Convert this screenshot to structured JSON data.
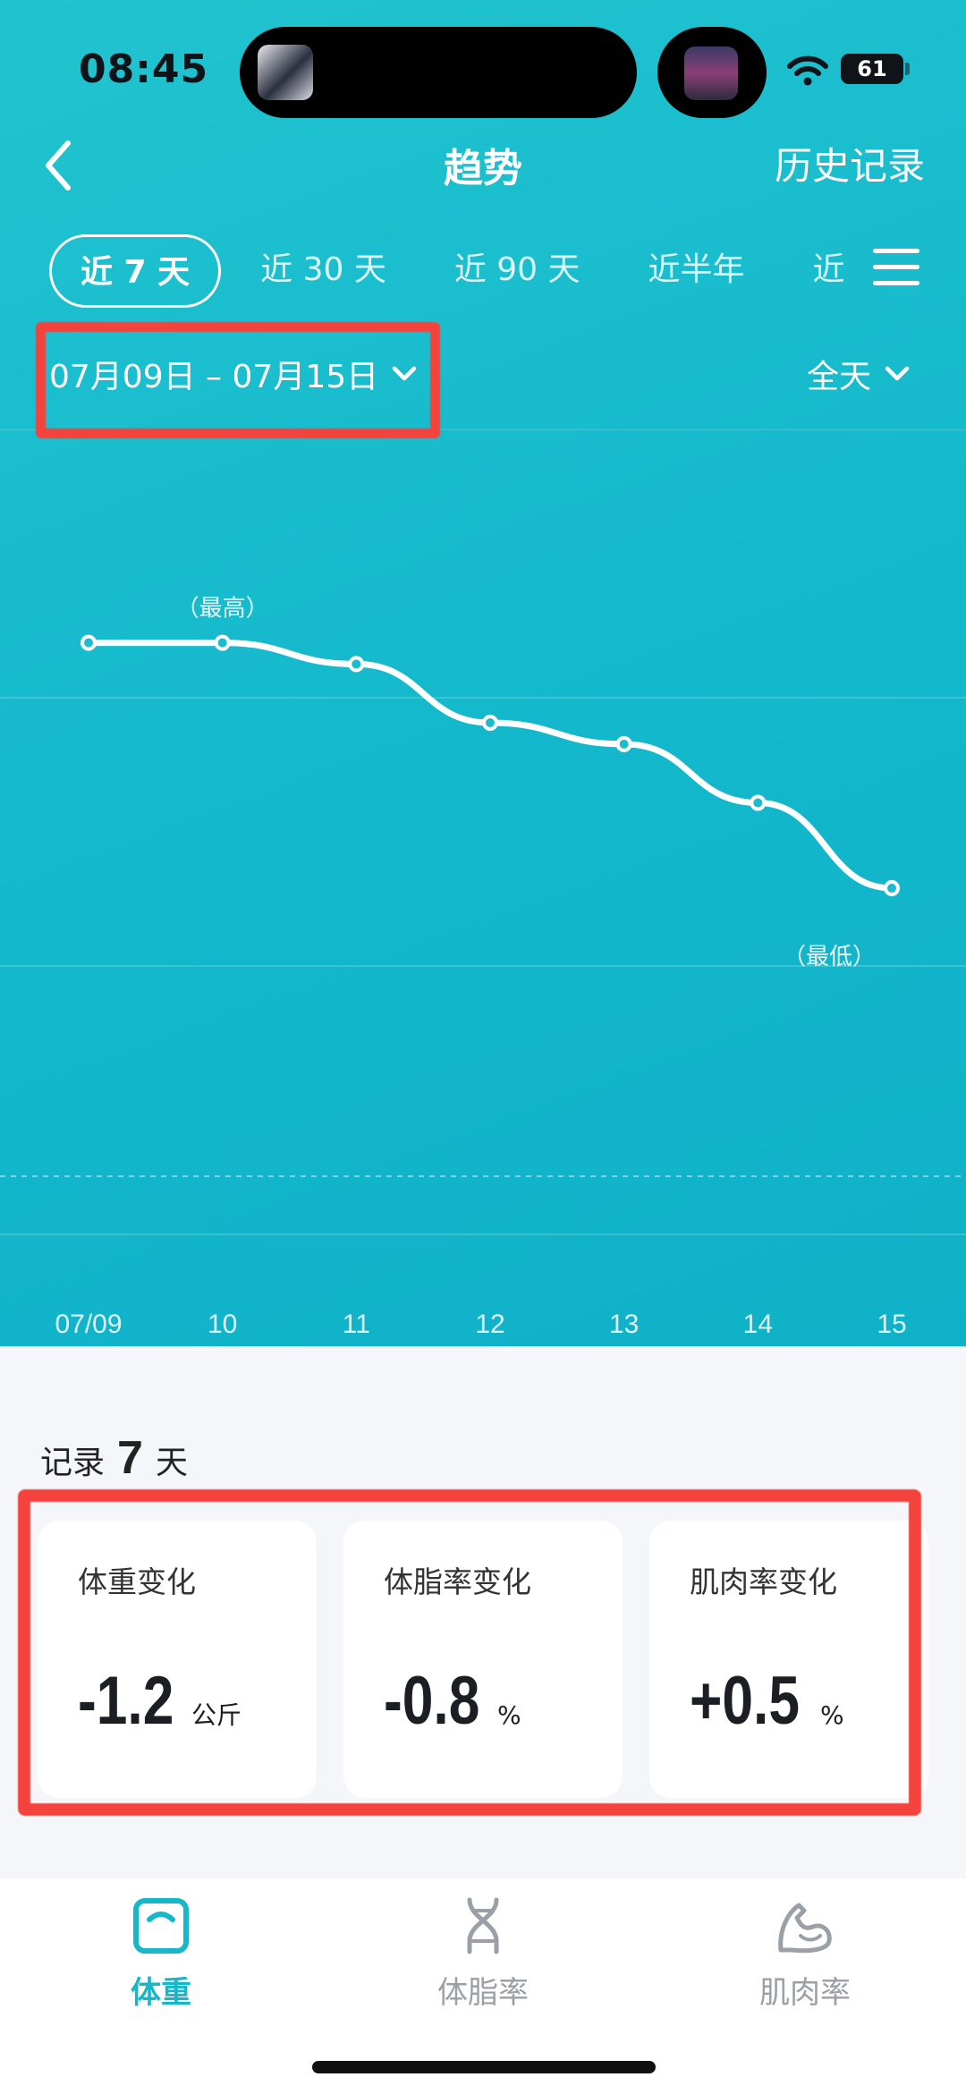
{
  "status_bar": {
    "time": "08:45",
    "battery": "61"
  },
  "header": {
    "title": "趋势",
    "right_action": "历史记录"
  },
  "tabs": [
    {
      "label": "近 7 天",
      "active": true
    },
    {
      "label": "近 30 天"
    },
    {
      "label": "近 90 天"
    },
    {
      "label": "近半年"
    },
    {
      "label": "近"
    }
  ],
  "date_range": "07月09日 – 07月15日",
  "period_select": "全天",
  "chart_data": {
    "type": "line",
    "x": [
      "07/09",
      "10",
      "11",
      "12",
      "13",
      "14",
      "15"
    ],
    "series": [
      {
        "values": [
          10,
          10,
          9.6,
          8.5,
          8.1,
          7.0,
          5.4
        ]
      }
    ],
    "ylim": [
      0,
      14
    ],
    "annotations": [
      {
        "x": "10",
        "text": "（最高）"
      },
      {
        "x": "15",
        "text": "（最低）"
      }
    ],
    "line_color": "#ffffff"
  },
  "records": {
    "prefix": "记录",
    "count": "7",
    "suffix": "天"
  },
  "cards": [
    {
      "label": "体重变化",
      "value": "-1.2",
      "unit": "公斤"
    },
    {
      "label": "体脂率变化",
      "value": "-0.8",
      "unit": "%"
    },
    {
      "label": "肌肉率变化",
      "value": "+0.5",
      "unit": "%"
    }
  ],
  "bottom_nav": [
    {
      "label": "体重",
      "icon": "scale-icon",
      "active": true
    },
    {
      "label": "体脂率",
      "icon": "dna-icon"
    },
    {
      "label": "肌肉率",
      "icon": "muscle-arm-icon"
    }
  ],
  "colors": {
    "accent": "#16b7c8",
    "annotation_red": "#f4433c"
  }
}
